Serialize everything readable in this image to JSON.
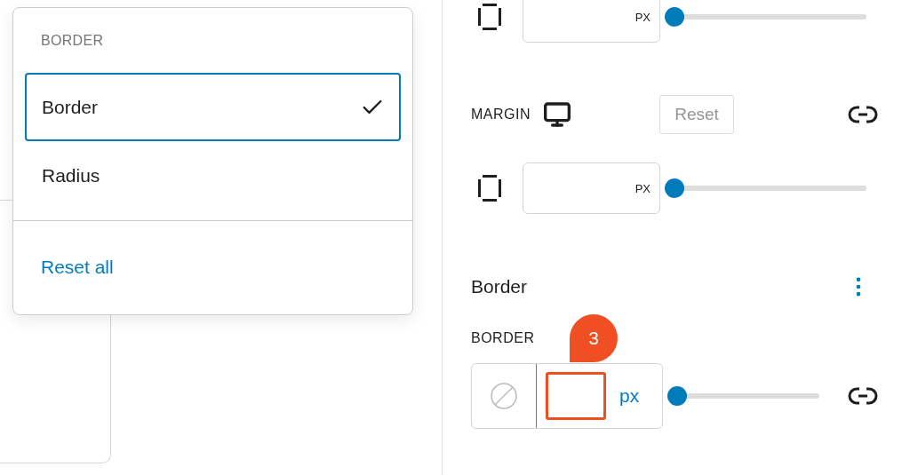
{
  "menu": {
    "heading": "BORDER",
    "options": [
      {
        "label": "Border",
        "selected": true
      },
      {
        "label": "Radius",
        "selected": false
      }
    ],
    "reset_all": "Reset all"
  },
  "panel": {
    "padding_row": {
      "unit": "PX",
      "level": 0
    },
    "margin": {
      "label": "MARGIN",
      "reset": "Reset",
      "reset_disabled": true,
      "unit": "PX",
      "level": 0
    },
    "border_section": {
      "title": "Border",
      "label": "BORDER",
      "unit": "px",
      "level": 0,
      "badge": "3"
    }
  }
}
